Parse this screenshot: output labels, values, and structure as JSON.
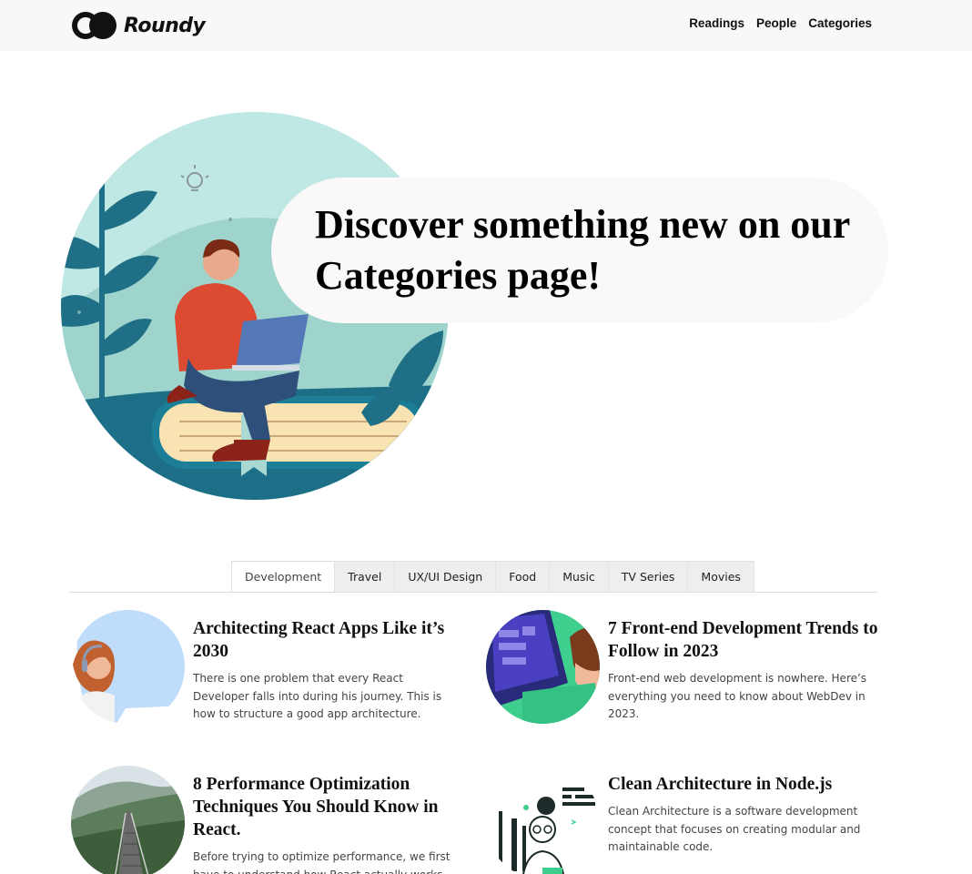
{
  "brand": {
    "name": "Roundy",
    "logo_icon": "double-circle-logo"
  },
  "nav": {
    "items": [
      "Readings",
      "People",
      "Categories"
    ]
  },
  "hero": {
    "headline": "Discover something new on our Categories page!",
    "illustration": "person-reading-on-book"
  },
  "tabs": {
    "items": [
      "Development",
      "Travel",
      "UX/UI Design",
      "Food",
      "Music",
      "TV Series",
      "Movies"
    ],
    "active": "Development"
  },
  "articles": [
    {
      "title": "Architecting React Apps Like it’s 2030",
      "description": "There is one problem that every React Developer falls into during his journey. This is how to structure a good app architecture.",
      "image": "woman-with-headset-illustration"
    },
    {
      "title": "7 Front-end Development Trends to Follow in 2023",
      "description": "Front-end web development is nowhere. Here’s everything you need to know about WebDev in 2023.",
      "image": "developer-at-screen-illustration"
    },
    {
      "title": "8 Performance Optimization Techniques You Should Know in React.",
      "description": "Before trying to optimize performance, we first have to understand how React actually works.",
      "image": "mountain-stairway-photo"
    },
    {
      "title": "Clean Architecture in Node.js",
      "description": "Clean Architecture is a software development concept that focuses on creating modular and maintainable code.",
      "image": "coder-woman-line-illustration"
    }
  ]
}
